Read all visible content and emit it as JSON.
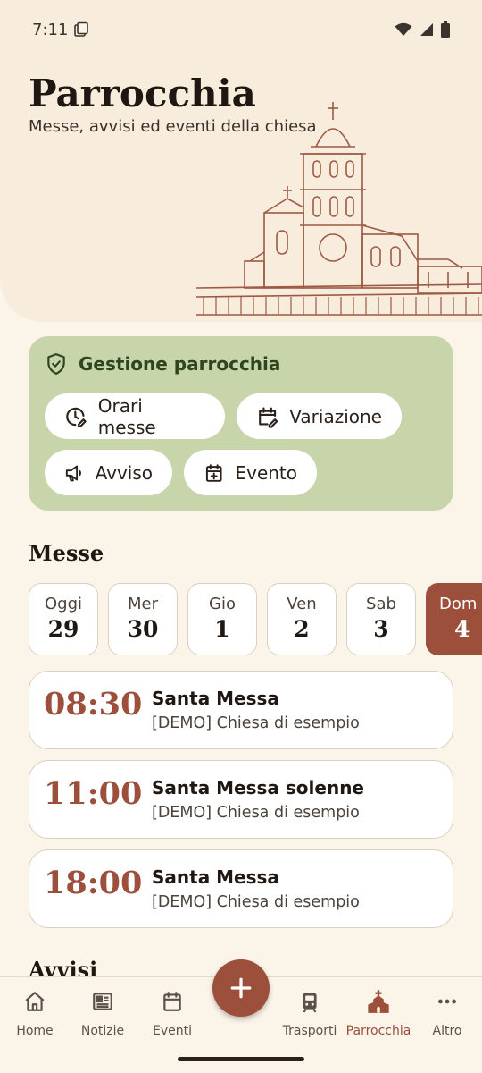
{
  "status": {
    "time": "7:11"
  },
  "header": {
    "title": "Parrocchia",
    "subtitle": "Messe, avvisi ed eventi della chiesa"
  },
  "manage": {
    "title": "Gestione parrocchia",
    "buttons": [
      {
        "label": "Orari messe",
        "icon": "clock-edit-icon"
      },
      {
        "label": "Variazione",
        "icon": "calendar-edit-icon"
      },
      {
        "label": "Avviso",
        "icon": "megaphone-icon"
      },
      {
        "label": "Evento",
        "icon": "calendar-plus-icon"
      }
    ]
  },
  "masses_section": {
    "title": "Messe",
    "days": [
      {
        "name": "Oggi",
        "num": "29"
      },
      {
        "name": "Mer",
        "num": "30"
      },
      {
        "name": "Gio",
        "num": "1"
      },
      {
        "name": "Ven",
        "num": "2"
      },
      {
        "name": "Sab",
        "num": "3"
      },
      {
        "name": "Dom",
        "num": "4",
        "selected": true
      }
    ],
    "items": [
      {
        "time": "08:30",
        "name": "Santa Messa",
        "place": "[DEMO] Chiesa di esempio"
      },
      {
        "time": "11:00",
        "name": "Santa Messa solenne",
        "place": "[DEMO] Chiesa di esempio"
      },
      {
        "time": "18:00",
        "name": "Santa Messa",
        "place": "[DEMO] Chiesa di esempio"
      }
    ]
  },
  "notices_section": {
    "title": "Avvisi"
  },
  "nav": {
    "items": [
      {
        "label": "Home",
        "icon": "home-icon"
      },
      {
        "label": "Notizie",
        "icon": "newspaper-icon"
      },
      {
        "label": "Eventi",
        "icon": "calendar-icon"
      },
      {
        "label": "Trasporti",
        "icon": "train-icon"
      },
      {
        "label": "Parrocchia",
        "icon": "church-icon",
        "active": true
      },
      {
        "label": "Altro",
        "icon": "more-icon"
      }
    ],
    "fab_icon": "plus-icon"
  },
  "colors": {
    "background": "#fbf4e8",
    "accent": "#9c4f3b",
    "manage_card": "#c8d4a9",
    "manage_text": "#2f4520"
  }
}
